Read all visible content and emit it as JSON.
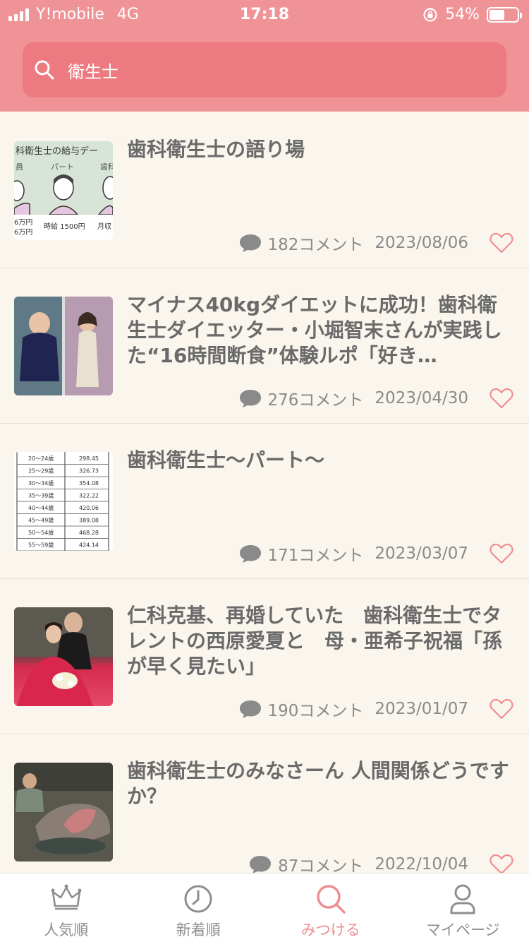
{
  "status_bar": {
    "carrier": "Y!mobile",
    "network": "4G",
    "time": "17:18",
    "battery_percent": "54%",
    "battery_level": 0.54
  },
  "search": {
    "query": "衛生士",
    "icon": "search-icon"
  },
  "colors": {
    "header": "#f09397",
    "search_field": "#ec7a80",
    "background": "#faf6ee",
    "accent": "#ef8e92"
  },
  "articles": [
    {
      "title": "歯科衛生士の語り場",
      "comments": "182コメント",
      "date": "2023/08/06",
      "thumb_text": {
        "heading": "科衛生士の給与デー",
        "left": "員",
        "middle": "パート",
        "right": "歯科",
        "pay_left_1": "6万円",
        "pay_left_2": "6万円",
        "pay_middle": "時給 1500円",
        "pay_right": "月収"
      }
    },
    {
      "title": "マイナス40kgダイエットに成功！歯科衛生士ダイエッター・小堀智末さんが実践した“16時間断食”体験ルポ「好き…",
      "comments": "276コメント",
      "date": "2023/04/30"
    },
    {
      "title": "歯科衛生士〜パート〜",
      "comments": "171コメント",
      "date": "2023/03/07",
      "thumb_table": [
        [
          "20〜24歳",
          "298.45"
        ],
        [
          "25〜29歳",
          "326.73"
        ],
        [
          "30〜34歳",
          "354.08"
        ],
        [
          "35〜39歳",
          "322.22"
        ],
        [
          "40〜44歳",
          "420.06"
        ],
        [
          "45〜49歳",
          "389.08"
        ],
        [
          "50〜54歳",
          "468.28"
        ],
        [
          "55〜59歳",
          "424.14"
        ]
      ]
    },
    {
      "title": "仁科克基、再婚していた　歯科衛生士でタレントの西原愛夏と　母・亜希子祝福「孫が早く見たい」",
      "comments": "190コメント",
      "date": "2023/01/07"
    },
    {
      "title": "歯科衛生士のみなさーん 人間関係どうですか？",
      "comments": "87コメント",
      "date": "2022/10/04"
    }
  ],
  "tabs": [
    {
      "label": "人気順",
      "icon": "crown-icon",
      "active": false
    },
    {
      "label": "新着順",
      "icon": "clock-icon",
      "active": false
    },
    {
      "label": "みつける",
      "icon": "search-icon",
      "active": true
    },
    {
      "label": "マイページ",
      "icon": "person-icon",
      "active": false
    }
  ]
}
